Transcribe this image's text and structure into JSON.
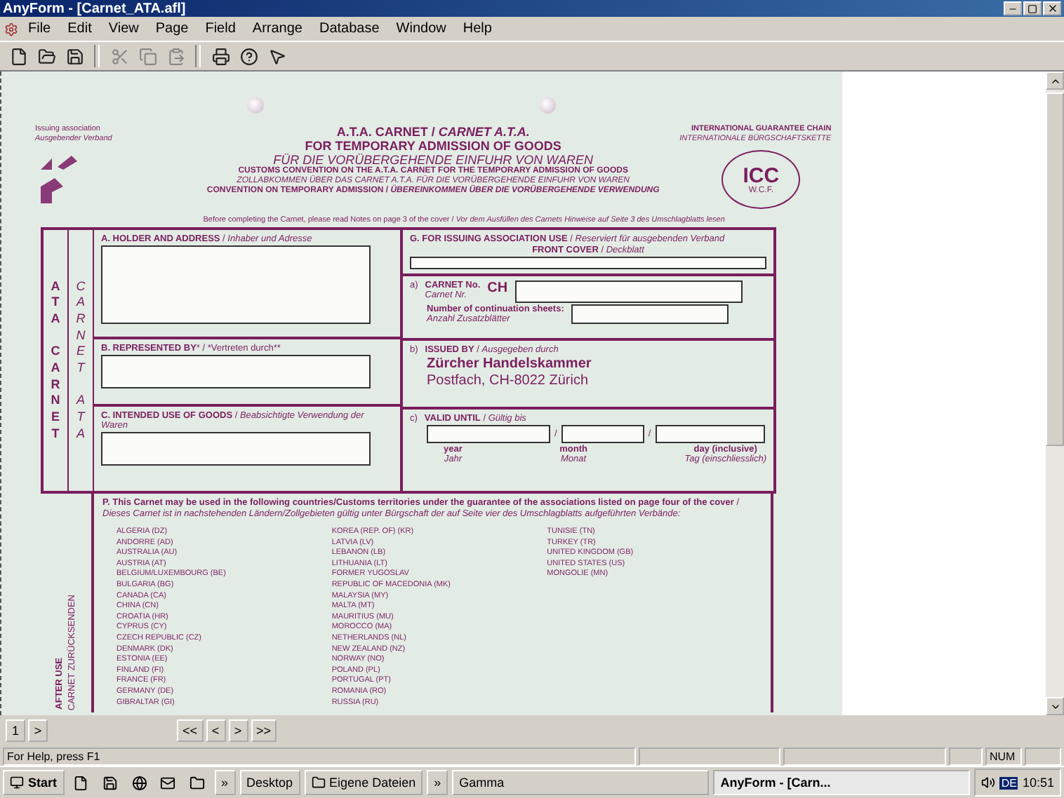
{
  "window": {
    "title": "AnyForm - [Carnet_ATA.afl]"
  },
  "menu": [
    "File",
    "Edit",
    "View",
    "Page",
    "Field",
    "Arrange",
    "Database",
    "Window",
    "Help"
  ],
  "form": {
    "issuer": [
      "Issuing association",
      "Ausgebender Verband"
    ],
    "titles": [
      {
        "kind": "plain",
        "text": "A.T.A. CARNET / *CARNET A.T.A.*"
      },
      {
        "kind": "big",
        "text": "FOR TEMPORARY ADMISSION OF GOODS"
      },
      {
        "kind": "italic",
        "text": "FÜR DIE VORÜBERGEHENDE EINFUHR VON WAREN"
      },
      {
        "kind": "small",
        "text": "CUSTOMS CONVENTION ON THE A.T.A. CARNET FOR THE TEMPORARY ADMISSION OF GOODS"
      },
      {
        "kind": "smallitalic",
        "text": "ZOLLABKOMMEN ÜBER DAS CARNET A.T.A. FÜR DIE VORÜBERGEHENDE EINFUHR VON WAREN"
      },
      {
        "kind": "small",
        "text": "CONVENTION ON TEMPORARY ADMISSION / *ÜBEREINKOMMEN ÜBER DIE VORÜBERGEHENDE VERWENDUNG*"
      }
    ],
    "guarantee": [
      "INTERNATIONAL GUARANTEE CHAIN",
      "INTERNATIONALE BÜRGSCHAFTSKETTE"
    ],
    "logo": {
      "mark": "ICC",
      "sub": "W.C.F."
    },
    "notice": "Before completing the Carnet, please read Notes on page 3 of the cover / *Vor dem Ausfüllen des Carnets Hinweise auf Seite 3 des Umschlagblatts lesen*",
    "side_labels": [
      {
        "text": "ATA CARNET",
        "italic": false
      },
      {
        "text": "CARNET ATA",
        "italic": true
      }
    ],
    "left_sections": [
      {
        "label": "**A. HOLDER AND ADDRESS** / *Inhaber und Adresse*"
      },
      {
        "label": "**B. REPRESENTED BY*** / *Vertreten durch**"
      },
      {
        "label": "**C. INTENDED USE OF GOODS** / *Beabsichtigte Verwendung der Waren*"
      }
    ],
    "section_g": {
      "label": "**G. FOR ISSUING ASSOCIATION USE** / *Reserviert für ausgebenden Verband*",
      "sub": "**FRONT COVER** / *Deckblatt*"
    },
    "section_a": {
      "letter": "a)",
      "label": "**CARNET No.**",
      "label_de": "Carnet Nr.",
      "prefix": "CH",
      "sheets": "**Number of continuation sheets:**",
      "sheets_de": "Anzahl Zusatzblätter"
    },
    "section_b": {
      "letter": "b)",
      "label": "**ISSUED BY** / *Ausgegeben durch*",
      "name": "Zürcher Handelskammer",
      "address": "Postfach, CH-8022 Zürich"
    },
    "section_c": {
      "letter": "c)",
      "label": "**VALID UNTIL** / *Gültig bis*",
      "separator": "/",
      "parts": [
        {
          "en": "year",
          "de": "Jahr"
        },
        {
          "en": "month",
          "de": "Monat"
        },
        {
          "en": "day (inclusive)",
          "de": "Tag (einschliesslich)"
        }
      ]
    },
    "section_p": {
      "text": "**P. This Carnet may be used in the following countries/Customs territories under the guarantee of the associations listed on page four of the cover** / *Dieses Carnet ist in nachstehenden Ländern/Zollgebieten gültig unter Bürgschaft der auf Seite vier des Umschlagblatts aufgeführten Verbände:*",
      "side": [
        "AFTER USE",
        "CARNET ZURÜCKSENDEN"
      ],
      "columns": [
        [
          "ALGERIA (DZ)",
          "ANDORRE (AD)",
          "AUSTRALIA (AU)",
          "AUSTRIA (AT)",
          "BELGIUM/LUXEMBOURG (BE)",
          "BULGARIA (BG)",
          "CANADA (CA)",
          "CHINA (CN)",
          "CROATIA (HR)",
          "CYPRUS (CY)",
          "CZECH REPUBLIC (CZ)",
          "DENMARK (DK)",
          "ESTONIA (EE)",
          "FINLAND (FI)",
          "FRANCE (FR)",
          "GERMANY (DE)",
          "GIBRALTAR (GI)"
        ],
        [
          "KOREA (REP. OF) (KR)",
          "LATVIA (LV)",
          "LEBANON (LB)",
          "LITHUANIA (LT)",
          "FORMER YUGOSLAV",
          "REPUBLIC OF MACEDONIA (MK)",
          "MALAYSIA (MY)",
          "MALTA (MT)",
          "MAURITIUS (MU)",
          "MOROCCO (MA)",
          "NETHERLANDS (NL)",
          "NEW ZEALAND (NZ)",
          "NORWAY (NO)",
          "POLAND (PL)",
          "PORTUGAL (PT)",
          "ROMANIA (RO)",
          "RUSSIA (RU)"
        ],
        [
          "TUNISIE (TN)",
          "TURKEY (TR)",
          "UNITED KINGDOM (GB)",
          "UNITED STATES (US)",
          "MONGOLIE (MN)"
        ]
      ]
    }
  },
  "pager": {
    "page": "1",
    "next": ">",
    "nav": [
      "<<",
      "<",
      ">",
      ">>"
    ]
  },
  "status": {
    "text": "For Help, press F1",
    "indicator": "NUM"
  },
  "taskbar": {
    "start": "Start",
    "more": "»",
    "folders": [
      "Desktop",
      "Eigene Dateien"
    ],
    "tasks": [
      {
        "label": "Gamma",
        "selected": false
      },
      {
        "label": "AnyForm - [Carn...",
        "selected": true
      }
    ],
    "lang": "DE",
    "time": "10:51"
  }
}
